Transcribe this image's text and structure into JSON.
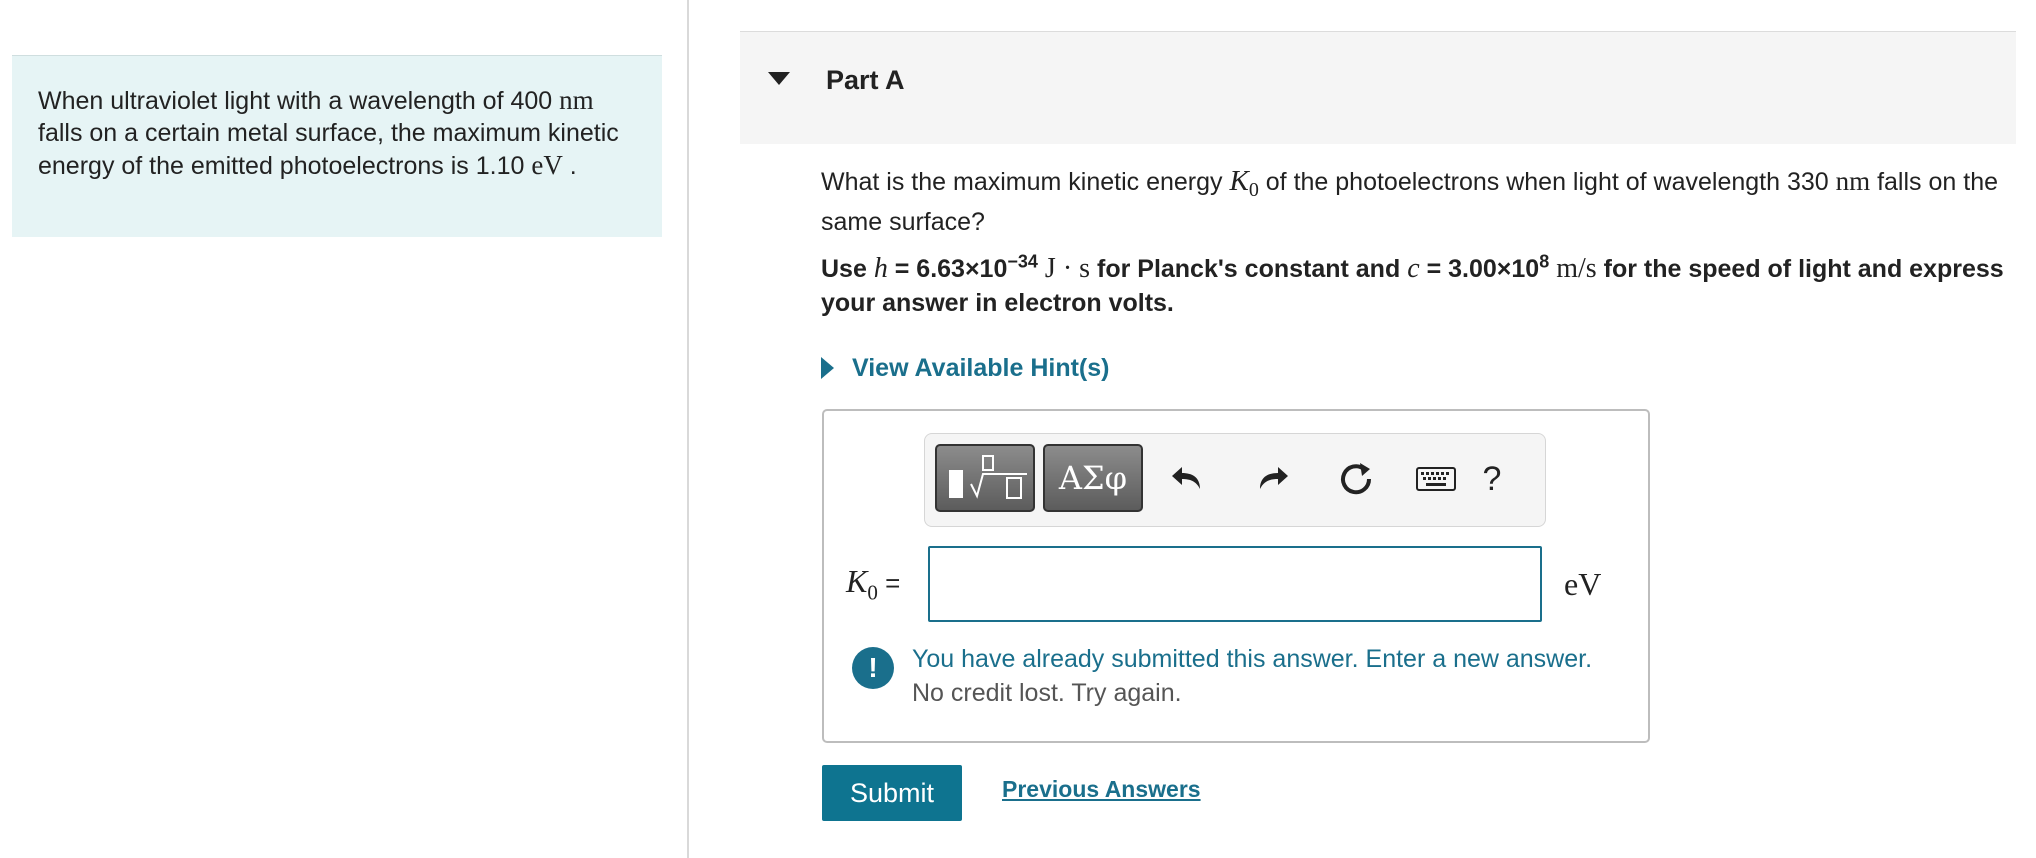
{
  "intro": {
    "text_1": "When ultraviolet light with a wavelength of 400 ",
    "wavelength_unit": "nm",
    "text_2": "falls on a certain metal surface, the maximum kinetic energy of the emitted photoelectrons is 1.10 ",
    "energy_unit": "eV",
    "text_3": " ."
  },
  "part": {
    "title": "Part A"
  },
  "question": {
    "text_1": "What is the maximum kinetic energy ",
    "symbol_K": "K",
    "symbol_sub": "0",
    "text_2": " of the photoelectrons when light of wavelength 330 ",
    "unit": "nm",
    "text_3": " falls on the same surface?"
  },
  "instructions": {
    "use": "Use ",
    "h_symbol": "h",
    "h_value": " = 6.63×10",
    "h_exp": "−34",
    "h_unit": " J · s",
    "planck": " for Planck's constant and ",
    "c_symbol": "c",
    "c_value": " = 3.00×10",
    "c_exp": "8",
    "c_unit": " m/s",
    "rest": " for the speed of light and express your answer in electron volts."
  },
  "hints": {
    "label": "View Available Hint(s)"
  },
  "toolbar": {
    "symbols_label": "ΑΣφ",
    "help_label": "?"
  },
  "answer": {
    "label_K": "K",
    "label_sub": "0",
    "equals": " =",
    "value": "",
    "unit": "eV"
  },
  "feedback": {
    "icon": "!",
    "message": "You have already submitted this answer. Enter a new answer.",
    "submessage": "No credit lost. Try again."
  },
  "actions": {
    "submit_label": "Submit",
    "previous_label": "Previous Answers"
  },
  "colors": {
    "accent": "#1a6f8c",
    "submit_bg": "#0e7490",
    "intro_bg": "#e6f4f5"
  }
}
